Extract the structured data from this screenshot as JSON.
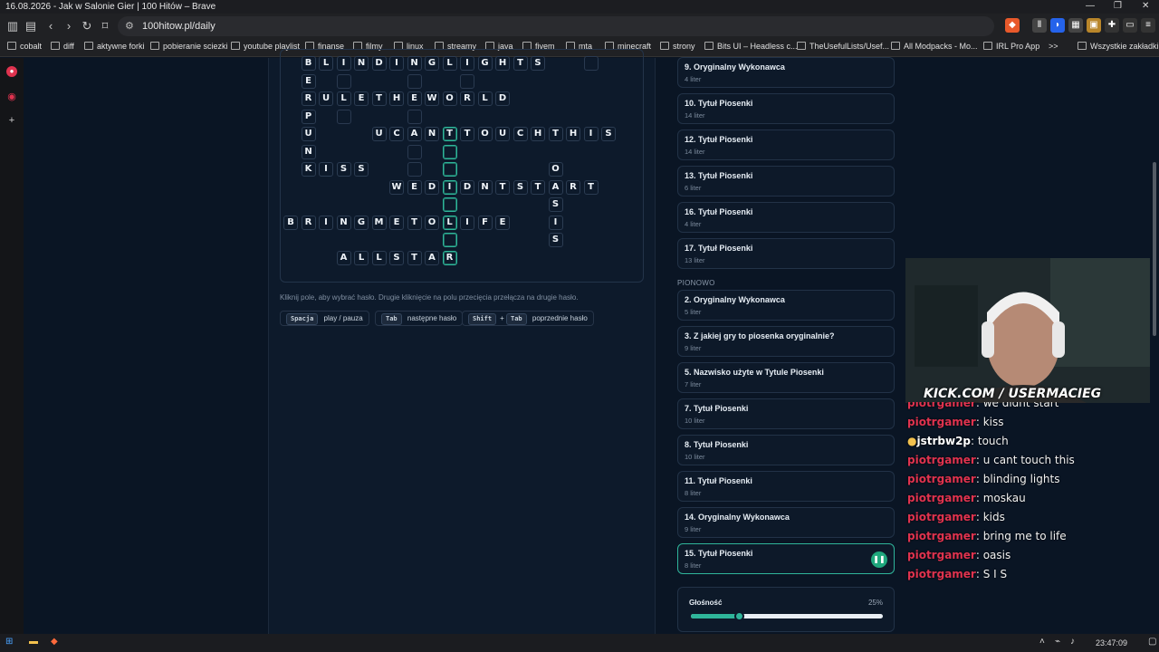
{
  "window": {
    "title": "16.08.2026 - Jak w Salonie Gier | 100 Hitów – Brave"
  },
  "toolbar": {
    "url": "100hitow.pl/daily"
  },
  "bookmarks": [
    "cobalt",
    "diff",
    "aktywne forki",
    "pobieranie sciezki",
    "youtube playlist",
    "finanse",
    "filmy",
    "linux",
    "streamy",
    "java",
    "fivem",
    "mta",
    "minecraft",
    "strony",
    "Bits UI – Headless c...",
    "TheUsefulLists/Usef...",
    "All Modpacks - Mo...",
    "IRL Pro App",
    ">>",
    "Wszystkie zakładki"
  ],
  "crossword": {
    "cells": [
      {
        "r": 0,
        "c": 1,
        "ch": "B"
      },
      {
        "r": 0,
        "c": 2,
        "ch": "L"
      },
      {
        "r": 0,
        "c": 3,
        "ch": "I"
      },
      {
        "r": 0,
        "c": 4,
        "ch": "N"
      },
      {
        "r": 0,
        "c": 5,
        "ch": "D"
      },
      {
        "r": 0,
        "c": 6,
        "ch": "I"
      },
      {
        "r": 0,
        "c": 7,
        "ch": "N"
      },
      {
        "r": 0,
        "c": 8,
        "ch": "G"
      },
      {
        "r": 0,
        "c": 9,
        "ch": "L"
      },
      {
        "r": 0,
        "c": 10,
        "ch": "I"
      },
      {
        "r": 0,
        "c": 11,
        "ch": "G"
      },
      {
        "r": 0,
        "c": 12,
        "ch": "H"
      },
      {
        "r": 0,
        "c": 13,
        "ch": "T"
      },
      {
        "r": 0,
        "c": 14,
        "ch": "S"
      },
      {
        "r": 0,
        "c": 17,
        "ch": ""
      },
      {
        "r": 1,
        "c": 1,
        "ch": "E"
      },
      {
        "r": 1,
        "c": 3,
        "ch": ""
      },
      {
        "r": 1,
        "c": 7,
        "ch": ""
      },
      {
        "r": 1,
        "c": 10,
        "ch": ""
      },
      {
        "r": 2,
        "c": 1,
        "ch": "R"
      },
      {
        "r": 2,
        "c": 2,
        "ch": "U"
      },
      {
        "r": 2,
        "c": 3,
        "ch": "L"
      },
      {
        "r": 2,
        "c": 4,
        "ch": "E"
      },
      {
        "r": 2,
        "c": 5,
        "ch": "T"
      },
      {
        "r": 2,
        "c": 6,
        "ch": "H"
      },
      {
        "r": 2,
        "c": 7,
        "ch": "E"
      },
      {
        "r": 2,
        "c": 8,
        "ch": "W"
      },
      {
        "r": 2,
        "c": 9,
        "ch": "O"
      },
      {
        "r": 2,
        "c": 10,
        "ch": "R"
      },
      {
        "r": 2,
        "c": 11,
        "ch": "L"
      },
      {
        "r": 2,
        "c": 12,
        "ch": "D"
      },
      {
        "r": 3,
        "c": 1,
        "ch": "P"
      },
      {
        "r": 3,
        "c": 3,
        "ch": ""
      },
      {
        "r": 3,
        "c": 7,
        "ch": ""
      },
      {
        "r": 4,
        "c": 1,
        "ch": "U"
      },
      {
        "r": 4,
        "c": 5,
        "ch": "U"
      },
      {
        "r": 4,
        "c": 6,
        "ch": "C"
      },
      {
        "r": 4,
        "c": 7,
        "ch": "A"
      },
      {
        "r": 4,
        "c": 8,
        "ch": "N"
      },
      {
        "r": 4,
        "c": 9,
        "ch": "T"
      },
      {
        "r": 4,
        "c": 10,
        "ch": "T"
      },
      {
        "r": 4,
        "c": 11,
        "ch": "O"
      },
      {
        "r": 4,
        "c": 12,
        "ch": "U"
      },
      {
        "r": 4,
        "c": 13,
        "ch": "C"
      },
      {
        "r": 4,
        "c": 14,
        "ch": "H"
      },
      {
        "r": 4,
        "c": 15,
        "ch": "T"
      },
      {
        "r": 4,
        "c": 16,
        "ch": "H"
      },
      {
        "r": 4,
        "c": 17,
        "ch": "I"
      },
      {
        "r": 4,
        "c": 18,
        "ch": "S"
      },
      {
        "r": 5,
        "c": 1,
        "ch": "N"
      },
      {
        "r": 5,
        "c": 7,
        "ch": ""
      },
      {
        "r": 5,
        "c": 9,
        "ch": ""
      },
      {
        "r": 6,
        "c": 1,
        "ch": "K"
      },
      {
        "r": 6,
        "c": 2,
        "ch": "I"
      },
      {
        "r": 6,
        "c": 3,
        "ch": "S"
      },
      {
        "r": 6,
        "c": 4,
        "ch": "S"
      },
      {
        "r": 6,
        "c": 7,
        "ch": ""
      },
      {
        "r": 6,
        "c": 9,
        "ch": ""
      },
      {
        "r": 6,
        "c": 15,
        "ch": "O"
      },
      {
        "r": 7,
        "c": 6,
        "ch": "W"
      },
      {
        "r": 7,
        "c": 7,
        "ch": "E"
      },
      {
        "r": 7,
        "c": 8,
        "ch": "D"
      },
      {
        "r": 7,
        "c": 9,
        "ch": "I"
      },
      {
        "r": 7,
        "c": 10,
        "ch": "D"
      },
      {
        "r": 7,
        "c": 11,
        "ch": "N"
      },
      {
        "r": 7,
        "c": 12,
        "ch": "T"
      },
      {
        "r": 7,
        "c": 13,
        "ch": "S"
      },
      {
        "r": 7,
        "c": 14,
        "ch": "T"
      },
      {
        "r": 7,
        "c": 15,
        "ch": "A"
      },
      {
        "r": 7,
        "c": 16,
        "ch": "R"
      },
      {
        "r": 7,
        "c": 17,
        "ch": "T"
      },
      {
        "r": 8,
        "c": 9,
        "ch": ""
      },
      {
        "r": 8,
        "c": 15,
        "ch": "S"
      },
      {
        "r": 9,
        "c": 0,
        "ch": "B"
      },
      {
        "r": 9,
        "c": 1,
        "ch": "R"
      },
      {
        "r": 9,
        "c": 2,
        "ch": "I"
      },
      {
        "r": 9,
        "c": 3,
        "ch": "N"
      },
      {
        "r": 9,
        "c": 4,
        "ch": "G"
      },
      {
        "r": 9,
        "c": 5,
        "ch": "M"
      },
      {
        "r": 9,
        "c": 6,
        "ch": "E"
      },
      {
        "r": 9,
        "c": 7,
        "ch": "T"
      },
      {
        "r": 9,
        "c": 8,
        "ch": "O"
      },
      {
        "r": 9,
        "c": 9,
        "ch": "L"
      },
      {
        "r": 9,
        "c": 10,
        "ch": "I"
      },
      {
        "r": 9,
        "c": 11,
        "ch": "F"
      },
      {
        "r": 9,
        "c": 12,
        "ch": "E"
      },
      {
        "r": 9,
        "c": 15,
        "ch": "I"
      },
      {
        "r": 10,
        "c": 9,
        "ch": ""
      },
      {
        "r": 10,
        "c": 15,
        "ch": "S"
      },
      {
        "r": 11,
        "c": 3,
        "ch": "A"
      },
      {
        "r": 11,
        "c": 4,
        "ch": "L"
      },
      {
        "r": 11,
        "c": 5,
        "ch": "L"
      },
      {
        "r": 11,
        "c": 6,
        "ch": "S"
      },
      {
        "r": 11,
        "c": 7,
        "ch": "T"
      },
      {
        "r": 11,
        "c": 8,
        "ch": "A"
      },
      {
        "r": 11,
        "c": 9,
        "ch": "R"
      }
    ],
    "highlight_col": 9,
    "hint": "Kliknij pole, aby wybrać hasło. Drugie kliknięcie na polu przecięcia przełącza na drugie hasło.",
    "shortcuts": [
      {
        "keys": [
          "Spacja"
        ],
        "label": "play / pauza"
      },
      {
        "keys": [
          "Tab"
        ],
        "label": "następne hasło"
      },
      {
        "keys": [
          "Shift",
          "Tab"
        ],
        "label": "poprzednie hasło"
      }
    ]
  },
  "clues_across": [
    {
      "title": "9. Oryginalny Wykonawca",
      "sub": "4 liter"
    },
    {
      "title": "10. Tytuł Piosenki",
      "sub": "14 liter"
    },
    {
      "title": "12. Tytuł Piosenki",
      "sub": "14 liter"
    },
    {
      "title": "13. Tytuł Piosenki",
      "sub": "6 liter"
    },
    {
      "title": "16. Tytuł Piosenki",
      "sub": "4 liter"
    },
    {
      "title": "17. Tytuł Piosenki",
      "sub": "13 liter"
    }
  ],
  "section_down": "PIONOWO",
  "clues_down": [
    {
      "title": "2. Oryginalny Wykonawca",
      "sub": "5 liter"
    },
    {
      "title": "3. Z jakiej gry to piosenka oryginalnie?",
      "sub": "9 liter"
    },
    {
      "title": "5. Nazwisko użyte w Tytule Piosenki",
      "sub": "7 liter"
    },
    {
      "title": "7. Tytuł Piosenki",
      "sub": "10 liter"
    },
    {
      "title": "8. Tytuł Piosenki",
      "sub": "10 liter"
    },
    {
      "title": "11. Tytuł Piosenki",
      "sub": "8 liter"
    },
    {
      "title": "14. Oryginalny Wykonawca",
      "sub": "9 liter"
    },
    {
      "title": "15. Tytuł Piosenki",
      "sub": "8 liter",
      "active": true
    }
  ],
  "volume": {
    "label": "Głośność",
    "percent_text": "25%",
    "level": 0.25
  },
  "stream": {
    "overlay": "KICK.COM / USERMACIEG"
  },
  "chat": [
    {
      "user": "piotrgamer",
      "text": ": we didnt start"
    },
    {
      "user": "piotrgamer",
      "text": ": kiss"
    },
    {
      "user": "jstrbw2p",
      "text": ": touch",
      "badge": true
    },
    {
      "user": "piotrgamer",
      "text": ": u cant touch this"
    },
    {
      "user": "piotrgamer",
      "text": ": blinding lights"
    },
    {
      "user": "piotrgamer",
      "text": ": moskau"
    },
    {
      "user": "piotrgamer",
      "text": ": kids"
    },
    {
      "user": "piotrgamer",
      "text": ": bring me to life"
    },
    {
      "user": "piotrgamer",
      "text": ": oasis"
    },
    {
      "user": "piotrgamer",
      "text": ": S I S"
    }
  ],
  "taskbar": {
    "time": "23:47:09"
  },
  "colors": {
    "accent": "#2fb59a",
    "chat_user": "#e0334f",
    "bg": "#0a1524"
  }
}
